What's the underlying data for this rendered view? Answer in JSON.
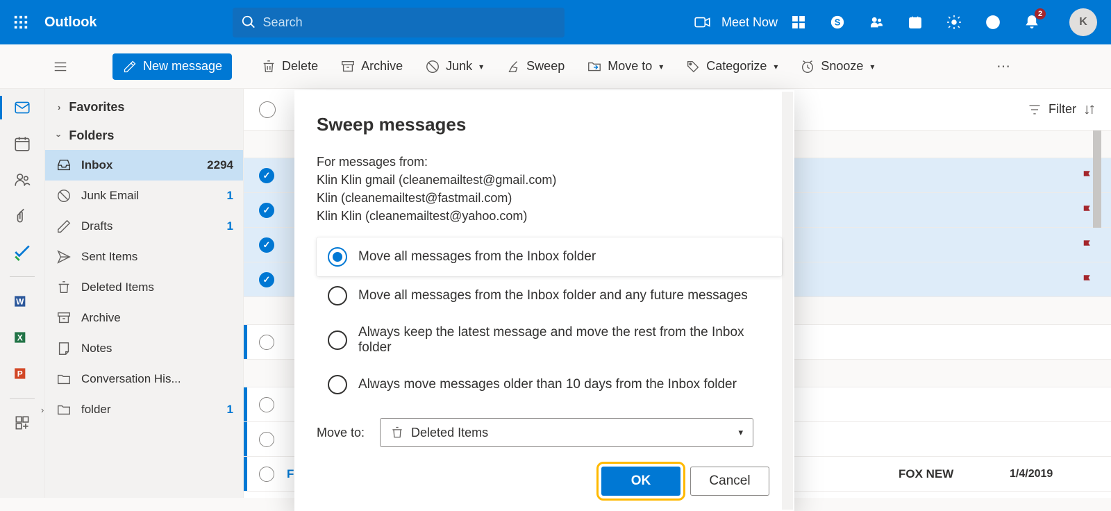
{
  "app_name": "Outlook",
  "search": {
    "placeholder": "Search"
  },
  "meet_now": "Meet Now",
  "notif_badge": "2",
  "avatar_initial": "K",
  "toolbar": {
    "new_message": "New message",
    "delete": "Delete",
    "archive": "Archive",
    "junk": "Junk",
    "sweep": "Sweep",
    "move_to": "Move to",
    "categorize": "Categorize",
    "snooze": "Snooze"
  },
  "folder_sections": {
    "favorites": "Favorites",
    "folders": "Folders"
  },
  "folders": [
    {
      "label": "Inbox",
      "count": "2294",
      "selected": true
    },
    {
      "label": "Junk Email",
      "count": "1",
      "selected": false
    },
    {
      "label": "Drafts",
      "count": "1",
      "selected": false
    },
    {
      "label": "Sent Items",
      "count": "",
      "selected": false
    },
    {
      "label": "Deleted Items",
      "count": "",
      "selected": false
    },
    {
      "label": "Archive",
      "count": "",
      "selected": false
    },
    {
      "label": "Notes",
      "count": "",
      "selected": false
    },
    {
      "label": "Conversation His...",
      "count": "",
      "selected": false
    },
    {
      "label": "folder",
      "count": "1",
      "selected": false
    }
  ],
  "filter_label": "Filter",
  "visible_messages": [
    {
      "subject": "Fox News First",
      "sender": "FOX NEW",
      "date": "1/4/2019"
    }
  ],
  "dialog": {
    "title": "Sweep messages",
    "from_label": "For messages from:",
    "senders": [
      "Klin Klin gmail (cleanemailtest@gmail.com)",
      "Klin (cleanemailtest@fastmail.com)",
      "Klin Klin (cleanemailtest@yahoo.com)"
    ],
    "options": [
      "Move all messages from the Inbox folder",
      "Move all messages from the Inbox folder and any future messages",
      "Always keep the latest message and move the rest from the Inbox folder",
      "Always move messages older than 10 days from the Inbox folder"
    ],
    "selected_option": 0,
    "move_to_label": "Move to:",
    "move_to_value": "Deleted Items",
    "ok_label": "OK",
    "cancel_label": "Cancel"
  }
}
